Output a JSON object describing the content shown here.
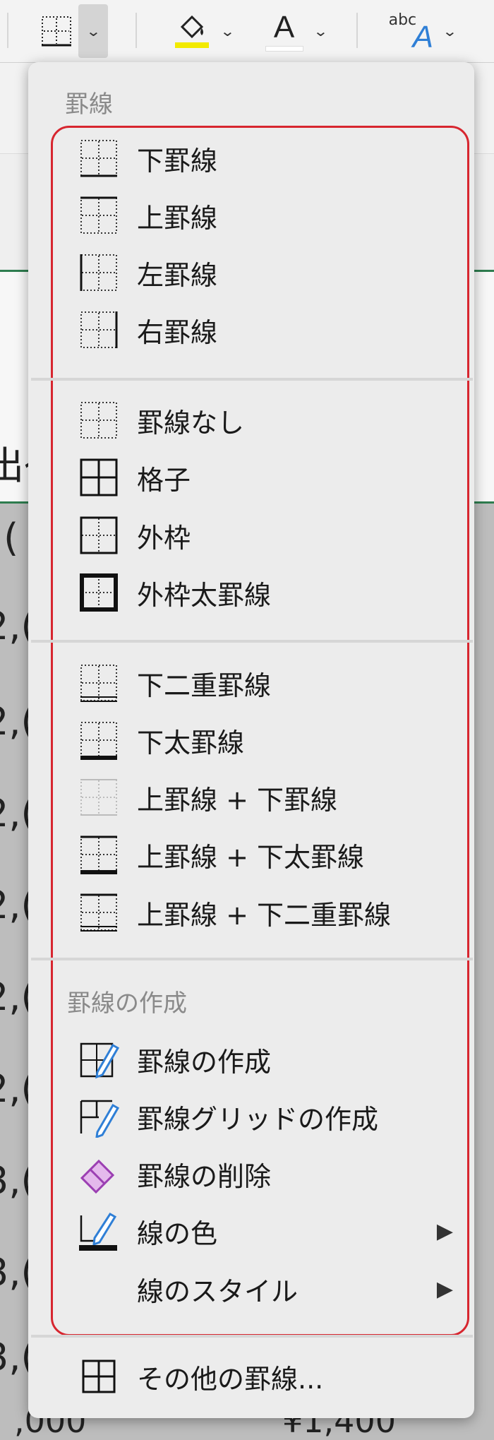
{
  "background": {
    "left_edge_glyphs": [
      "出ｲ",
      ",(",
      "2,(",
      "2,(",
      "2,(",
      "2,(",
      "2,(",
      "2,(",
      "3,(",
      "3,(",
      "3,("
    ],
    "bottom_left_text": ",000",
    "bottom_right_text": "¥1,400"
  },
  "menu": {
    "section_borders": "罫線",
    "section_draw": "罫線の作成",
    "items": [
      {
        "label": "下罫線",
        "icon": "bottom-border-icon"
      },
      {
        "label": "上罫線",
        "icon": "top-border-icon"
      },
      {
        "label": "左罫線",
        "icon": "left-border-icon"
      },
      {
        "label": "右罫線",
        "icon": "right-border-icon"
      },
      {
        "label": "罫線なし",
        "icon": "no-border-icon"
      },
      {
        "label": "格子",
        "icon": "all-borders-icon"
      },
      {
        "label": "外枠",
        "icon": "outside-borders-icon"
      },
      {
        "label": "外枠太罫線",
        "icon": "thick-outside-borders-icon"
      },
      {
        "label": "下二重罫線",
        "icon": "bottom-double-border-icon"
      },
      {
        "label": "下太罫線",
        "icon": "thick-bottom-border-icon"
      },
      {
        "label": "上罫線 + 下罫線",
        "icon": "top-and-bottom-border-icon"
      },
      {
        "label": "上罫線 + 下太罫線",
        "icon": "top-and-thick-bottom-border-icon"
      },
      {
        "label": "上罫線 + 下二重罫線",
        "icon": "top-and-double-bottom-border-icon"
      },
      {
        "label": "罫線の作成",
        "icon": "draw-border-icon"
      },
      {
        "label": "罫線グリッドの作成",
        "icon": "draw-border-grid-icon"
      },
      {
        "label": "罫線の削除",
        "icon": "eraser-icon"
      },
      {
        "label": "線の色",
        "icon": "line-color-icon",
        "submenu": "▶"
      },
      {
        "label": "線のスタイル",
        "icon": "",
        "submenu": "▶"
      },
      {
        "label": "その他の罫線...",
        "icon": "more-borders-icon"
      }
    ],
    "highlight_color": "#d7262f"
  },
  "ribbon": {
    "font_color_letter": "A",
    "style_text": "abc",
    "style_letter": "A",
    "fill_color": "#f2ea00"
  }
}
